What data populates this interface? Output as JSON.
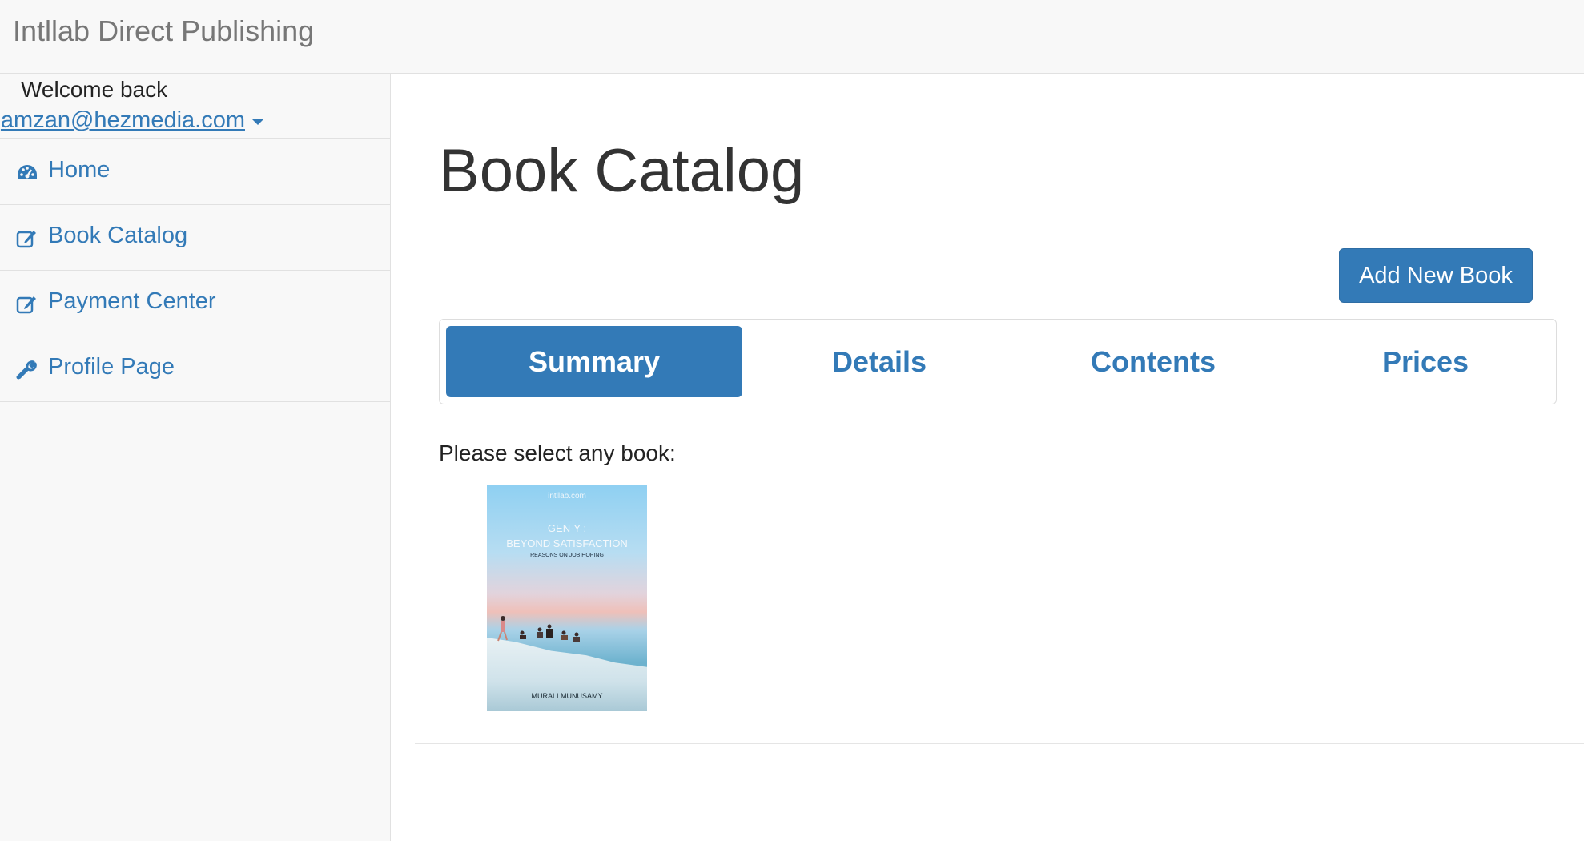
{
  "navbar": {
    "brand": "Intllab Direct Publishing"
  },
  "sidebar": {
    "welcome": "Welcome back",
    "user_email": "amzan@hezmedia.com",
    "items": [
      {
        "label": "Home",
        "icon": "dashboard-icon"
      },
      {
        "label": "Book Catalog",
        "icon": "edit-icon"
      },
      {
        "label": "Payment Center",
        "icon": "edit-icon"
      },
      {
        "label": "Profile Page",
        "icon": "wrench-icon"
      }
    ]
  },
  "main": {
    "title": "Book Catalog",
    "add_button": "Add New Book",
    "tabs": [
      {
        "label": "Summary",
        "active": true
      },
      {
        "label": "Details",
        "active": false
      },
      {
        "label": "Contents",
        "active": false
      },
      {
        "label": "Prices",
        "active": false
      }
    ],
    "prompt": "Please select any book:",
    "books": [
      {
        "site": "intllab.com",
        "title_line1": "GEN-Y :",
        "title_line2": "BEYOND SATISFACTION",
        "subtitle": "REASONS ON JOB HOPING",
        "author": "MURALI MUNUSAMY"
      }
    ]
  },
  "colors": {
    "accent": "#337ab7",
    "navbar_bg": "#f8f8f8",
    "border": "#e1e1e1"
  }
}
